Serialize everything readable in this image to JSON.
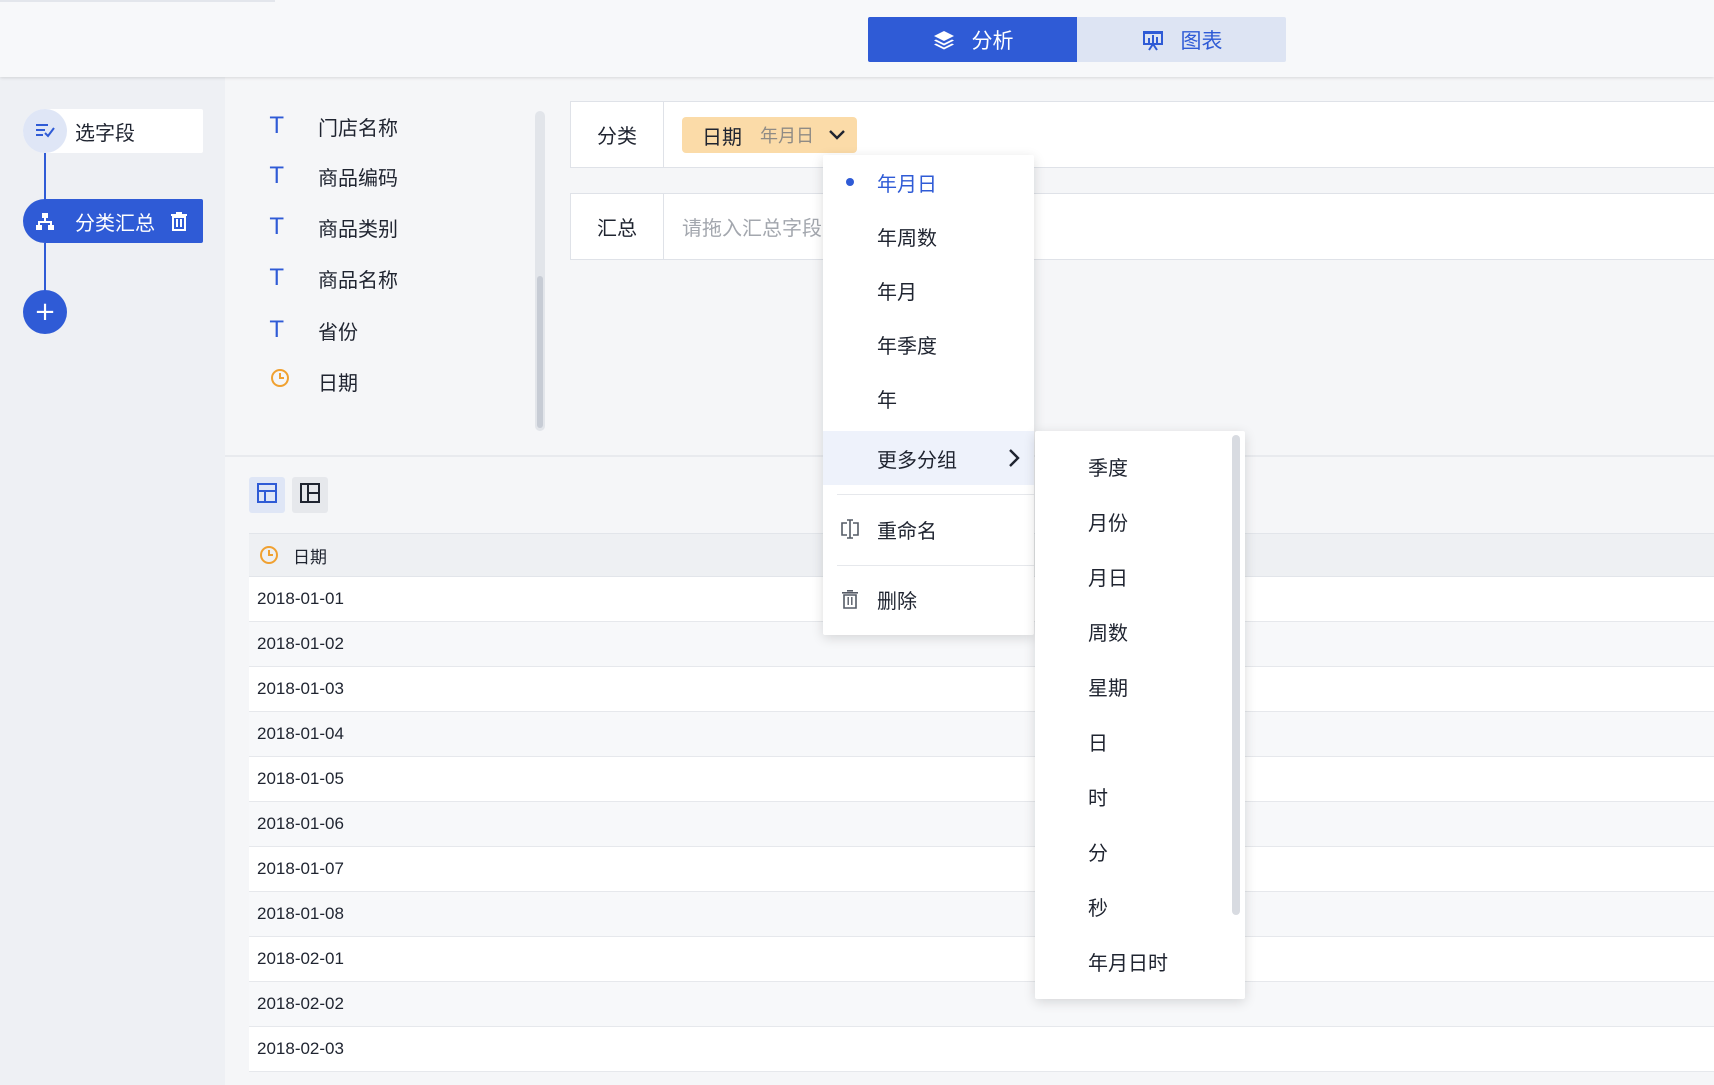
{
  "tabs": {
    "analysis_label": "分析",
    "chart_label": "图表"
  },
  "flow": {
    "step_select_label": "选字段",
    "step_group_label": "分类汇总",
    "add_label": "+"
  },
  "fields": [
    {
      "type": "T",
      "name": "门店名称"
    },
    {
      "type": "T",
      "name": "商品编码"
    },
    {
      "type": "T",
      "name": "商品类别"
    },
    {
      "type": "T",
      "name": "商品名称"
    },
    {
      "type": "T",
      "name": "省份"
    },
    {
      "type": "date",
      "name": "日期"
    }
  ],
  "zones": {
    "category_label": "分类",
    "category_chip_field": "日期",
    "category_chip_granularity": "年月日",
    "summary_label": "汇总",
    "summary_placeholder": "请拖入汇总字段"
  },
  "menu": {
    "items": [
      "年月日",
      "年周数",
      "年月",
      "年季度",
      "年"
    ],
    "active": "年月日",
    "more_label": "更多分组",
    "rename_label": "重命名",
    "delete_label": "删除"
  },
  "submenu": {
    "items": [
      "季度",
      "月份",
      "月日",
      "周数",
      "星期",
      "日",
      "时",
      "分",
      "秒",
      "年月日时"
    ]
  },
  "table": {
    "header": "日期",
    "rows": [
      "2018-01-01",
      "2018-01-02",
      "2018-01-03",
      "2018-01-04",
      "2018-01-05",
      "2018-01-06",
      "2018-01-07",
      "2018-01-08",
      "2018-02-01",
      "2018-02-02",
      "2018-02-03"
    ]
  },
  "colors": {
    "accent": "#2f5bd6",
    "chip_bg": "#fbdba8",
    "clock_icon": "#f0a131"
  },
  "icons": [
    "layers-icon",
    "chart-icon",
    "select-fields-icon",
    "hierarchy-icon",
    "trash-icon",
    "plus-icon",
    "text-type-icon",
    "clock-icon",
    "chevron-down-icon",
    "chevron-right-icon",
    "rename-icon",
    "delete-icon",
    "layout-table-icon",
    "layout-pivot-icon"
  ]
}
